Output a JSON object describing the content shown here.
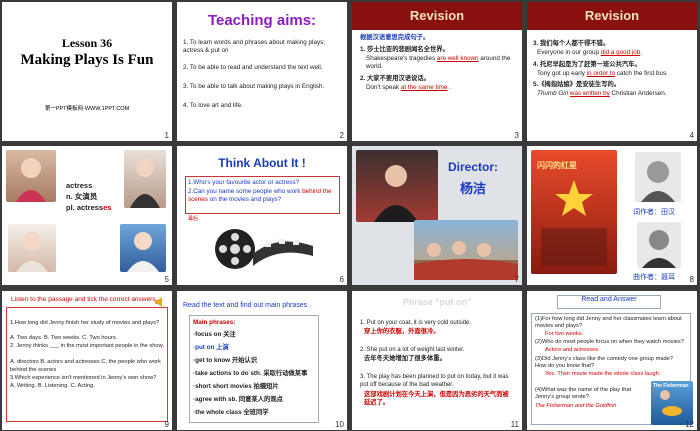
{
  "s1": {
    "lesson": "Lesson 36",
    "title": "Making Plays Is Fun",
    "footer": "第一PPT模板网-WWW.1PPT.COM",
    "num": "1"
  },
  "s2": {
    "heading": "Teaching aims:",
    "items": [
      "1. To learn words and phrases about making plays: actress & put on",
      "2. To be able to read and understand the text well.",
      "3. To be able to talk about making plays in English.",
      "4. To love art and life."
    ],
    "num": "2"
  },
  "s3": {
    "heading": "Revision",
    "intro": "根据汉语意思完成句子。",
    "q1_cn": "1. 莎士比亚的悲剧闻名全世界。",
    "q1_a": "Shakespeare's tragedies",
    "q1_b": "are well known",
    "q1_c": "around the world.",
    "q2_cn": "2. 大家不要用汉语说话。",
    "q2_a": "Don't speak",
    "q2_b": "at the same time",
    "q2_c": ".",
    "num": "3"
  },
  "s4": {
    "heading": "Revision",
    "q3_cn": "3. 我们每个人都干得不错。",
    "q3_a": "Everyone in our group",
    "q3_b": "did a good job",
    "q3_c": ".",
    "q4_cn": "4. 托尼早起是为了赶第一班公共汽车。",
    "q4_a": "Tony got up early",
    "q4_b": "in order to",
    "q4_c": "catch the first bus.",
    "q5_cn": "5.《拇指姑娘》是安徒生写的。",
    "q5_a": "Thumb Girl",
    "q5_b": "was written by",
    "q5_c": "Christian Andersen.",
    "num": "4"
  },
  "s5": {
    "word": "actress",
    "pos": "n. 女演员",
    "plural_a": "pl. actress",
    "plural_b": "es",
    "num": "5"
  },
  "s6": {
    "heading": "Think About It !",
    "q1": "1.Who's your favourite actor or actress?",
    "q2a": "2.Can you name some people who work ",
    "q2b": "behind the scenes",
    "q2c": " on the movies and plays?",
    "note": "幕后",
    "num": "6"
  },
  "s7": {
    "label": "Director:",
    "name": "杨洁",
    "num": "7"
  },
  "s8": {
    "poster_title": "闪闪的红星",
    "caption1": "词作者：田汉",
    "caption2": "曲作者：聂耳",
    "num": "8"
  },
  "s9": {
    "heading": "Listen to the passage and tick the correct answers.",
    "lines": [
      "1.How long did Jenny finish her study of movies and plays?",
      "A. Two days.  B. Two weeks.  C. Two hours.",
      "2. Jenny thinks ___ in the most important people in the show.",
      "A. directors  B. actors and actresses  C. the people who work behind the scenes",
      "3.Which experience isn't mentioned in Jenny's own show?",
      "A. Writing.   B. Listening.   C. Acting."
    ],
    "num": "9"
  },
  "s10": {
    "heading": "Read the text and find out main phrases .",
    "box_title": "Main phrases:",
    "phrases": [
      "·focus on  关注",
      "·put on   上演",
      "·get to know  开始认识",
      "·take actions to do sth.  采取行动做某事",
      "·short short movies  拍摄短片",
      "·agree with sb.  同意某人的观点",
      "·the whole class  全班同学"
    ],
    "num": "10"
  },
  "s11": {
    "heading": "Phrase \"put on\"",
    "e1": "1. Put on your coat, it is very cold outside.",
    "e1_cn": "穿上你的衣服，外面很冷。",
    "e2": "2. She put on a lot of weight last winter.",
    "e2_cn": "去年冬天她增加了很多体重。",
    "e3": "3. The play has been planned to put on today, but it was put off because of the bad weather.",
    "e3_cn": "这部戏剧计划在今天上演，但是因为恶劣的天气而被延迟了。",
    "num": "11"
  },
  "s12": {
    "heading": "Read and Answer",
    "lines": [
      "(1)For how long did Jenny and her classmates learn about movies and plays?",
      "For two weeks.",
      "(2)Who do most people focus on when they watch movies?",
      "Actors and actresses.",
      "(3)Did Jenny's class like the comedy one group made? How do you know that?",
      "Yes. Their movie made the whole class laugh.",
      "(4)What was the name of the play that Jenny's group wrote?",
      "The Fisherman and the Goldfish"
    ],
    "poster": "The Fisherman",
    "num": "12"
  }
}
